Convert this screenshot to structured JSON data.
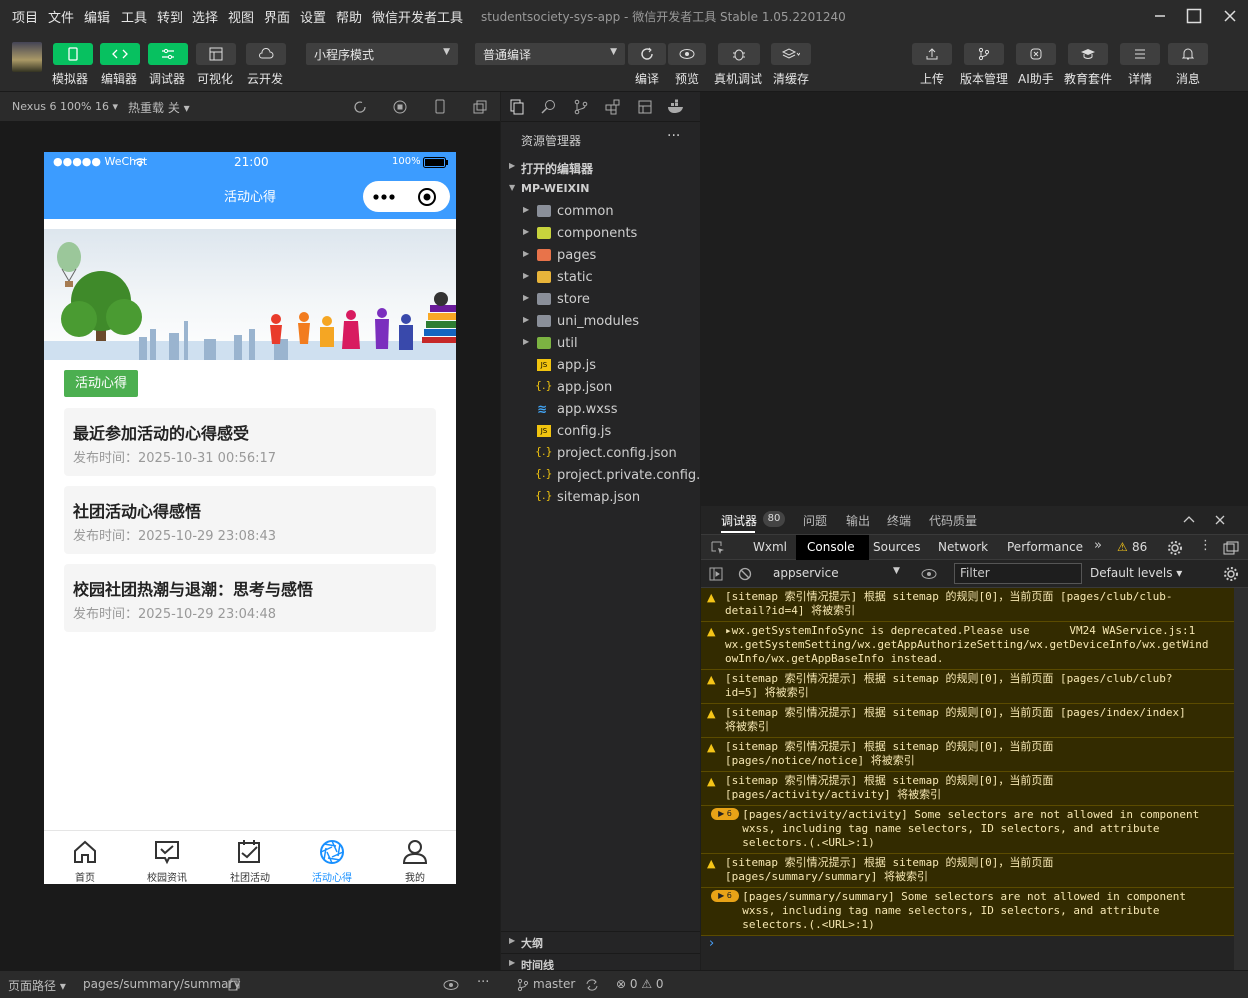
{
  "menu": [
    "项目",
    "文件",
    "编辑",
    "工具",
    "转到",
    "选择",
    "视图",
    "界面",
    "设置",
    "帮助",
    "微信开发者工具"
  ],
  "app_title": "studentsociety-sys-app - 微信开发者工具 Stable 1.05.2201240",
  "toolbar": {
    "left": [
      "模拟器",
      "编辑器",
      "调试器",
      "可视化",
      "云开发"
    ],
    "mode_select": "小程序模式",
    "compile_select": "普通编译",
    "mid": [
      "编译",
      "预览",
      "真机调试",
      "清缓存"
    ],
    "right": [
      "上传",
      "版本管理",
      "AI助手",
      "教育套件",
      "详情",
      "消息"
    ]
  },
  "subbar": {
    "device": "Nexus 6 100% 16",
    "hot_reload": "热重载 关"
  },
  "phone": {
    "status_carrier": "●●●●● WeChat",
    "status_time": "21:00",
    "status_battery": "100%",
    "nav_title": "活动心得",
    "tag": "活动心得",
    "cards": [
      {
        "title": "最近参加活动的心得感受",
        "meta": "发布时间：2025-10-31 00:56:17"
      },
      {
        "title": "社团活动心得感悟",
        "meta": "发布时间：2025-10-29 23:08:43"
      },
      {
        "title": "校园社团热潮与退潮：思考与感悟",
        "meta": "发布时间：2025-10-29 23:04:48"
      }
    ],
    "tabs": [
      "首页",
      "校园资讯",
      "社团活动",
      "活动心得",
      "我的"
    ],
    "active_tab_color": "#1890ff"
  },
  "explorer": {
    "title": "资源管理器",
    "open_editors": "打开的编辑器",
    "root": "MP-WEIXIN",
    "folders": [
      "common",
      "components",
      "pages",
      "static",
      "store",
      "uni_modules",
      "util"
    ],
    "files": [
      "app.js",
      "app.json",
      "app.wxss",
      "config.js",
      "project.config.json",
      "project.private.config.js...",
      "sitemap.json"
    ],
    "outline": "大纲",
    "timeline": "时间线"
  },
  "console": {
    "tabs": [
      "调试器",
      "问题",
      "输出",
      "终端",
      "代码质量"
    ],
    "debugger_badge": "80",
    "devtools_tabs": [
      "Wxml",
      "Console",
      "Sources",
      "Network",
      "Performance"
    ],
    "warn_count": "86",
    "context": "appservice",
    "filter_placeholder": "Filter",
    "levels": "Default levels",
    "logs": [
      "[sitemap 索引情况提示] 根据 sitemap 的规则[0]，当前页面 [pages/club/club-\ndetail?id=4] 将被索引",
      "▸wx.getSystemInfoSync is deprecated.Please use      VM24 WAService.js:1\nwx.getSystemSetting/wx.getAppAuthorizeSetting/wx.getDeviceInfo/wx.getWind\nowInfo/wx.getAppBaseInfo instead.",
      "[sitemap 索引情况提示] 根据 sitemap 的规则[0]，当前页面 [pages/club/club?\nid=5] 将被索引",
      "[sitemap 索引情况提示] 根据 sitemap 的规则[0]，当前页面 [pages/index/index]\n将被索引",
      "[sitemap 索引情况提示] 根据 sitemap 的规则[0]，当前页面\n[pages/notice/notice] 将被索引",
      "[sitemap 索引情况提示] 根据 sitemap 的规则[0]，当前页面\n[pages/activity/activity] 将被索引",
      "  [pages/activity/activity] Some selectors are not allowed in component\n  wxss, including tag name selectors, ID selectors, and attribute\n  selectors.(.<URL>:1)",
      "[sitemap 索引情况提示] 根据 sitemap 的规则[0]，当前页面\n[pages/summary/summary] 将被索引",
      "  [pages/summary/summary] Some selectors are not allowed in component\n  wxss, including tag name selectors, ID selectors, and attribute\n  selectors.(.<URL>:1)"
    ],
    "prompt": "›"
  },
  "statusbar": {
    "page_path_label": "页面路径",
    "page_path": "pages/summary/summary",
    "branch": "master",
    "counts": "⊗ 0 ⚠ 0"
  }
}
